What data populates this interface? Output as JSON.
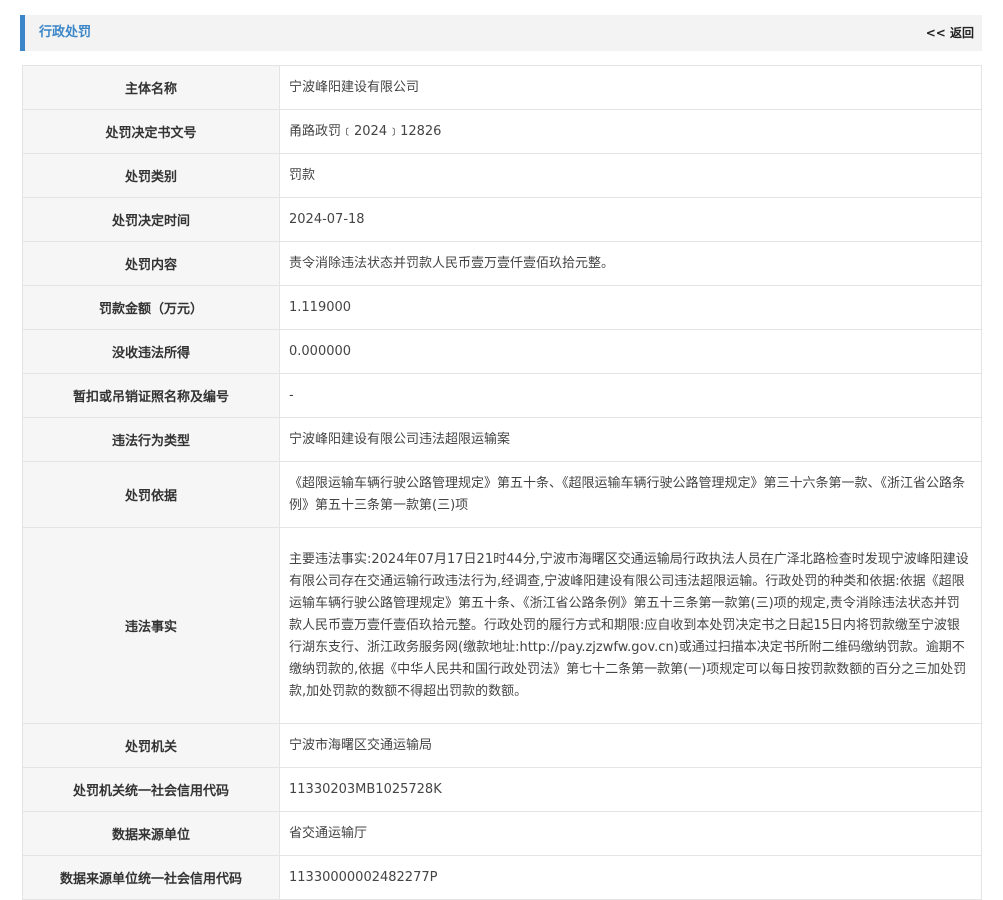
{
  "header": {
    "title": "行政处罚",
    "back_label": "<< 返回"
  },
  "rows": [
    {
      "label": "主体名称",
      "value": "宁波峰阳建设有限公司"
    },
    {
      "label": "处罚决定书文号",
      "value": "甬路政罚﹝2024﹞12826"
    },
    {
      "label": "处罚类别",
      "value": "罚款"
    },
    {
      "label": "处罚决定时间",
      "value": "2024-07-18"
    },
    {
      "label": "处罚内容",
      "value": "责令消除违法状态并罚款人民币壹万壹仟壹佰玖拾元整。"
    },
    {
      "label": "罚款金额（万元）",
      "value": "1.119000"
    },
    {
      "label": "没收违法所得",
      "value": "0.000000"
    },
    {
      "label": "暂扣或吊销证照名称及编号",
      "value": "-"
    },
    {
      "label": "违法行为类型",
      "value": "宁波峰阳建设有限公司违法超限运输案"
    },
    {
      "label": "处罚依据",
      "value": "《超限运输车辆行驶公路管理规定》第五十条、《超限运输车辆行驶公路管理规定》第三十六条第一款、《浙江省公路条例》第五十三条第一款第(三)项"
    },
    {
      "label": "违法事实",
      "value": "主要违法事实:2024年07月17日21时44分,宁波市海曙区交通运输局行政执法人员在广泽北路检查时发现宁波峰阳建设有限公司存在交通运输行政违法行为,经调查,宁波峰阳建设有限公司违法超限运输。行政处罚的种类和依据:依据《超限运输车辆行驶公路管理规定》第五十条、《浙江省公路条例》第五十三条第一款第(三)项的规定,责令消除违法状态并罚款人民币壹万壹仟壹佰玖拾元整。行政处罚的履行方式和期限:应自收到本处罚决定书之日起15日内将罚款缴至宁波银行湖东支行、浙江政务服务网(缴款地址:http://pay.zjzwfw.gov.cn)或通过扫描本决定书所附二维码缴纳罚款。逾期不缴纳罚款的,依据《中华人民共和国行政处罚法》第七十二条第一款第(一)项规定可以每日按罚款数额的百分之三加处罚款,加处罚款的数额不得超出罚款的数额。"
    },
    {
      "label": "处罚机关",
      "value": "宁波市海曙区交通运输局"
    },
    {
      "label": "处罚机关统一社会信用代码",
      "value": "11330203MB1025728K"
    },
    {
      "label": "数据来源单位",
      "value": "省交通运输厅"
    },
    {
      "label": "数据来源单位统一社会信用代码",
      "value": "11330000002482277P"
    }
  ]
}
